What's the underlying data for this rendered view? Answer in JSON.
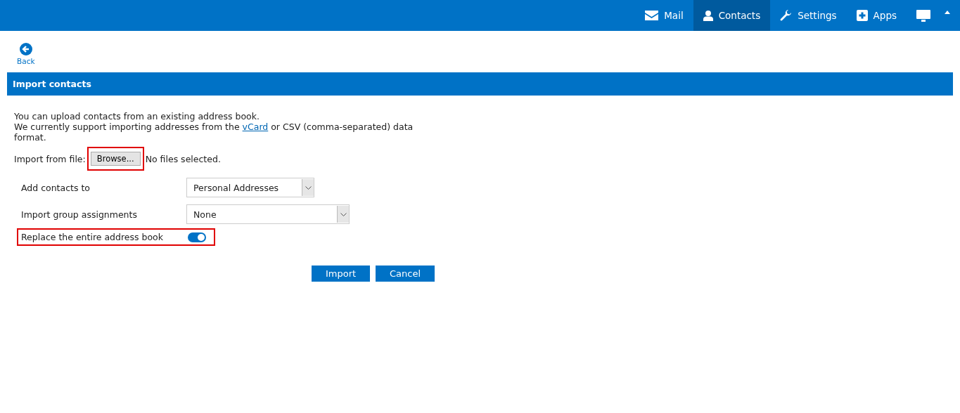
{
  "nav": [
    {
      "label": "Mail",
      "kind": "mail",
      "selected": false
    },
    {
      "label": "Contacts",
      "kind": "contacts",
      "selected": true
    },
    {
      "label": "Settings",
      "kind": "settings",
      "selected": false
    },
    {
      "label": "Apps",
      "kind": "apps",
      "selected": false
    },
    {
      "kind": "display",
      "selected": false
    }
  ],
  "back": {
    "label": "Back"
  },
  "section": {
    "title": "Import contacts"
  },
  "intro": {
    "line1": "You can upload contacts from an existing address book.",
    "before_link": "We currently support importing addresses from the ",
    "link": "vCard",
    "after_link": " or CSV (comma-separated) data format."
  },
  "file": {
    "label": "Import from file:",
    "button": "Browse...",
    "status": "No files selected.",
    "highlighted": true
  },
  "selects": [
    {
      "label": "Add contacts to",
      "value": "Personal Addresses",
      "wide": false
    },
    {
      "label": "Import group assignments",
      "value": "None",
      "wide": true
    }
  ],
  "replace": {
    "label": "Replace the entire address book",
    "on": true,
    "highlighted": true
  },
  "buttons": [
    "Import",
    "Cancel"
  ]
}
